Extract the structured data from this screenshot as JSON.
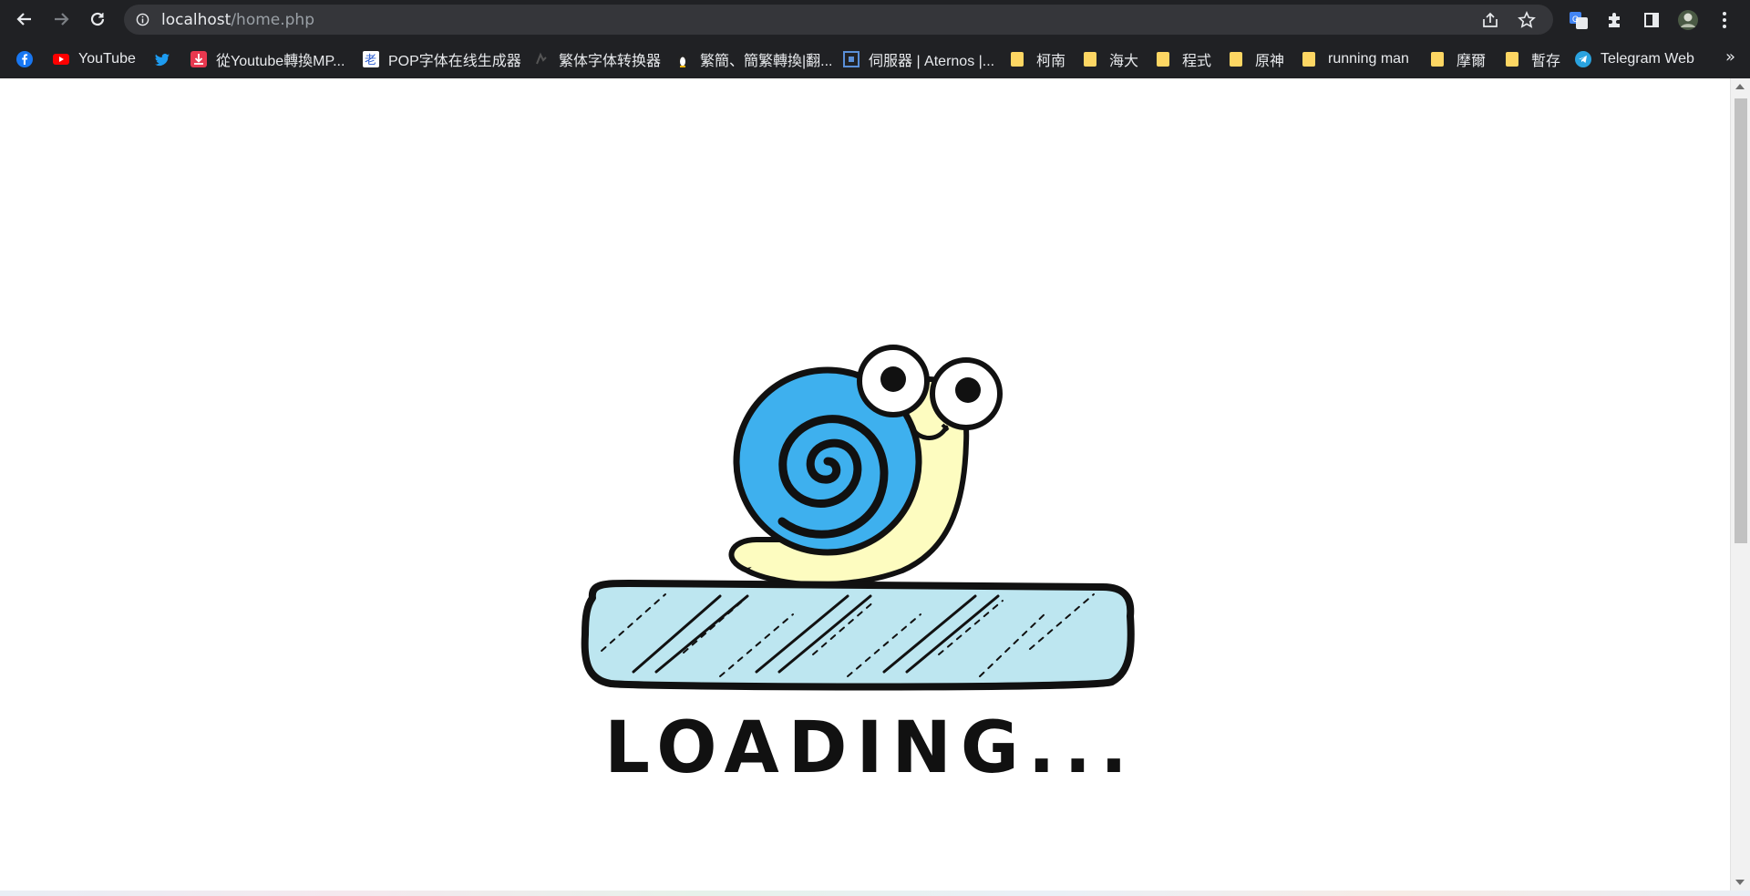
{
  "browser": {
    "url_host": "localhost",
    "url_path": "/home.php",
    "bookmarks": [
      {
        "label": "",
        "icon": "facebook-icon"
      },
      {
        "label": "YouTube",
        "icon": "youtube-icon"
      },
      {
        "label": "",
        "icon": "twitter-icon"
      },
      {
        "label": "從Youtube轉換MP...",
        "icon": "download-icon"
      },
      {
        "label": "POP字体在线生成器",
        "icon": "pop-font-icon"
      },
      {
        "label": "繁体字体转换器",
        "icon": "font-converter-icon"
      },
      {
        "label": "繁簡、簡繁轉換|翻...",
        "icon": "penguin-icon"
      },
      {
        "label": "伺服器 | Aternos |...",
        "icon": "aternos-icon"
      },
      {
        "label": "柯南",
        "icon": "folder-icon"
      },
      {
        "label": "海大",
        "icon": "folder-icon"
      },
      {
        "label": "程式",
        "icon": "folder-icon"
      },
      {
        "label": "原神",
        "icon": "folder-icon"
      },
      {
        "label": "running man",
        "icon": "folder-icon"
      },
      {
        "label": "摩爾",
        "icon": "folder-icon"
      },
      {
        "label": "暫存",
        "icon": "folder-icon"
      },
      {
        "label": "Telegram Web",
        "icon": "telegram-icon"
      }
    ],
    "more_bookmarks": "»"
  },
  "page": {
    "loading_text": "LOADING..."
  },
  "colors": {
    "chrome_bg": "#202124",
    "omnibox_bg": "#35363a",
    "snail_shell": "#3eb0ee",
    "snail_body": "#fdfcc0",
    "bar_fill": "#bde6f0",
    "folder": "#fdd663"
  }
}
